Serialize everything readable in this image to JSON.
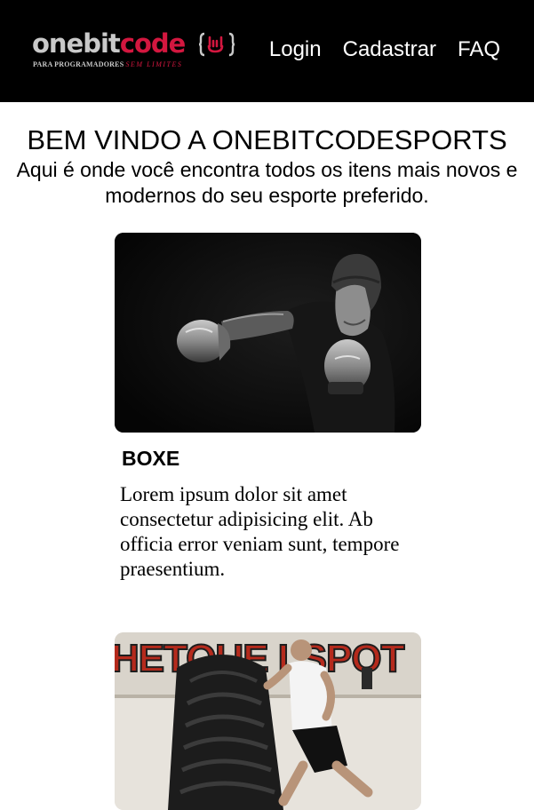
{
  "header": {
    "logo": {
      "one": "onebit",
      "code": "code",
      "tagline_a": "PARA PROGRAMADORES",
      "tagline_b": "SEM LIMITES"
    },
    "nav": [
      {
        "label": "Login"
      },
      {
        "label": "Cadastrar"
      },
      {
        "label": "FAQ"
      }
    ]
  },
  "hero": {
    "title": "BEM VINDO A ONEBITCODESPORTS",
    "subtitle": "Aqui é onde você encontra todos os itens mais novos e modernos do seu esporte preferido."
  },
  "cards": [
    {
      "title": "BOXE",
      "text": "Lorem ipsum dolor sit amet consectetur adipisicing elit. Ab officia error veniam sunt, tempore praesentium."
    },
    {
      "image_text": "HETOUE LSPOT"
    }
  ],
  "colors": {
    "header_bg": "#000000",
    "brand_red": "#d3173f",
    "logo_grey": "#c9c9c9"
  }
}
